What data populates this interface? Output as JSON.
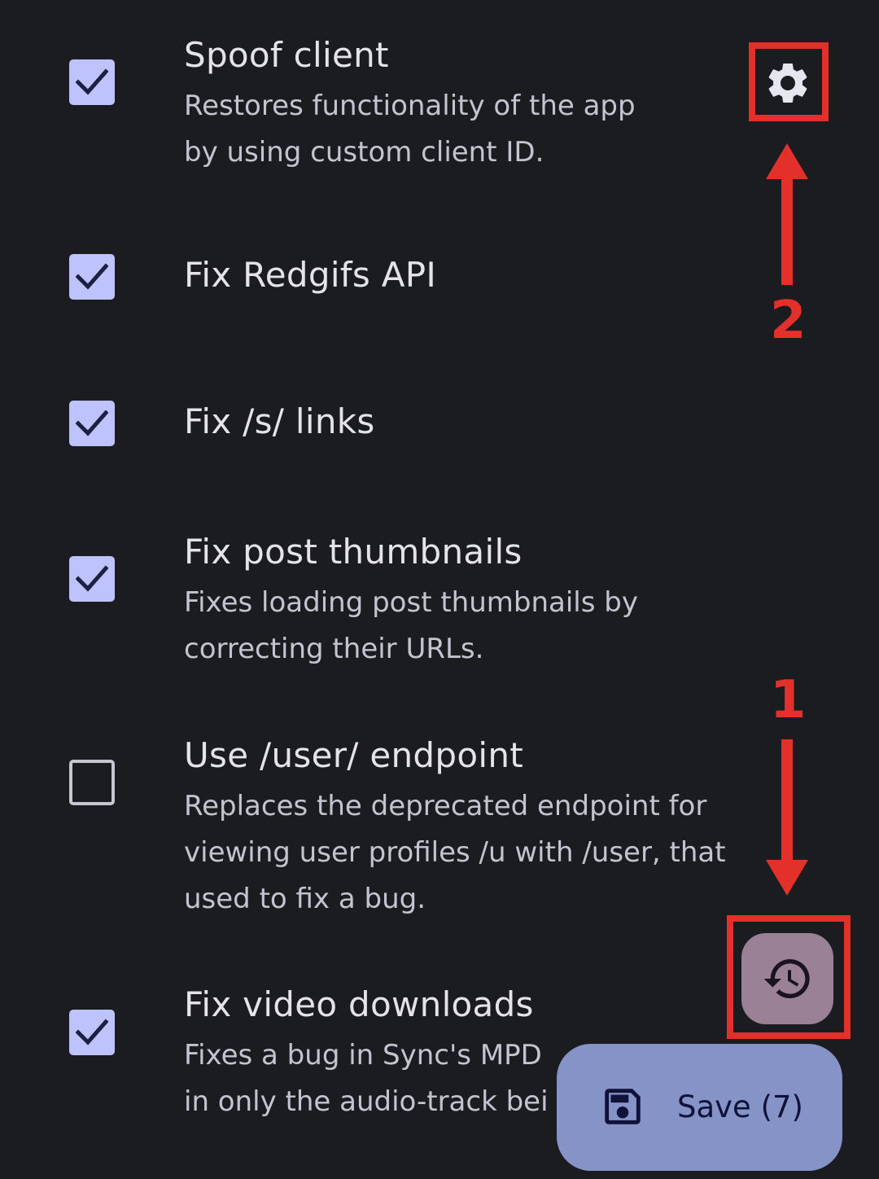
{
  "patches": [
    {
      "title": "Spoof client",
      "description_lines": [
        "Restores functionality of the app",
        "by using custom client ID."
      ],
      "checked": true
    },
    {
      "title": "Fix Redgifs API",
      "description_lines": [],
      "checked": true
    },
    {
      "title": "Fix /s/ links",
      "description_lines": [],
      "checked": true
    },
    {
      "title": "Fix post thumbnails",
      "description_lines": [
        "Fixes loading post thumbnails by",
        "correcting their URLs."
      ],
      "checked": true
    },
    {
      "title": "Use /user/ endpoint",
      "description_lines": [
        "Replaces the deprecated endpoint for",
        "viewing user profiles /u with /user, that",
        "used to fix a bug."
      ],
      "checked": false
    },
    {
      "title": "Fix video downloads",
      "description_lines": [
        "Fixes a bug in Sync's MPD",
        "in only the audio-track bei"
      ],
      "checked": true
    }
  ],
  "icons": {
    "settings": "gear-icon",
    "restore": "history-icon",
    "save": "save-icon"
  },
  "save_button": {
    "label": "Save (7)"
  },
  "annotations": {
    "step1": "1",
    "step2": "2"
  },
  "colors": {
    "background": "#1b1c20",
    "checkbox_checked": "#bec3fd",
    "annotation_red": "#e4302a",
    "restore_fab": "#9b8196",
    "save_fab": "#8593c7"
  }
}
